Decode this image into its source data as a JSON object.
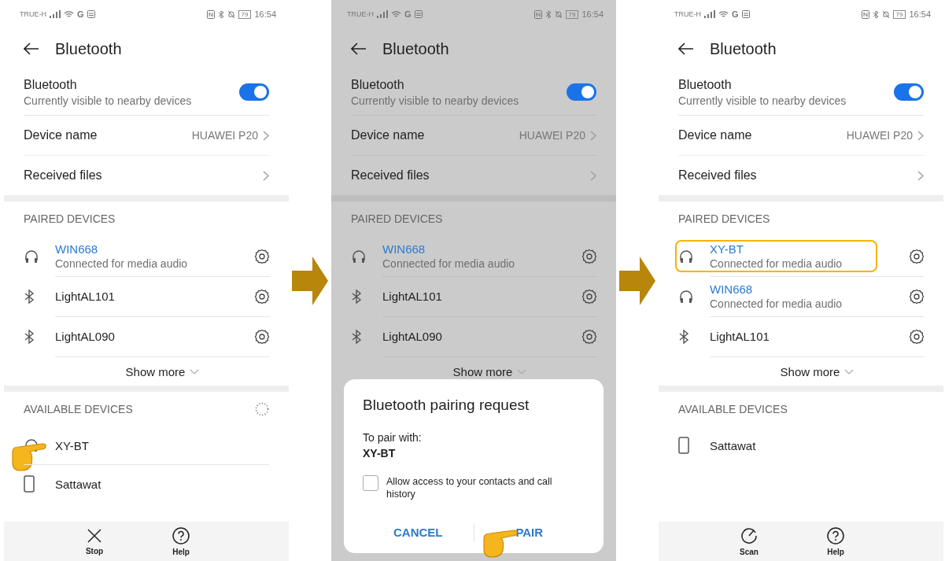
{
  "screens": [
    {
      "dimmed": false,
      "status_bar": {
        "carrier": "TRUE-H",
        "network": "G",
        "battery": "79",
        "time": "16:54"
      },
      "title": "Bluetooth",
      "bluetooth": {
        "label": "Bluetooth",
        "subtitle": "Currently visible to nearby devices",
        "on": true
      },
      "device_name": {
        "label": "Device name",
        "value": "HUAWEI P20"
      },
      "received_files": {
        "label": "Received files"
      },
      "paired": {
        "heading": "PAIRED DEVICES",
        "show_more": "Show more",
        "devices": [
          {
            "kind": "headphones",
            "name": "WIN668",
            "subtitle": "Connected for media audio",
            "connected": true,
            "highlighted": false
          },
          {
            "kind": "bluetooth",
            "name": "LightAL101",
            "connected": false,
            "highlighted": false
          },
          {
            "kind": "bluetooth",
            "name": "LightAL090",
            "connected": false,
            "highlighted": false
          }
        ]
      },
      "available": {
        "heading": "AVAILABLE DEVICES",
        "scanning": true,
        "devices": [
          {
            "kind": "headphones",
            "name": "XY-BT",
            "pointed": true
          },
          {
            "kind": "phone",
            "name": "Sattawat",
            "pointed": false
          }
        ]
      },
      "toolbar": [
        {
          "kind": "stop",
          "label": "Stop"
        },
        {
          "kind": "help",
          "label": "Help"
        }
      ]
    },
    {
      "dimmed": true,
      "status_bar": {
        "carrier": "TRUE-H",
        "network": "G",
        "battery": "79",
        "time": "16:54"
      },
      "title": "Bluetooth",
      "bluetooth": {
        "label": "Bluetooth",
        "subtitle": "Currently visible to nearby devices",
        "on": true
      },
      "device_name": {
        "label": "Device name",
        "value": "HUAWEI P20"
      },
      "received_files": {
        "label": "Received files"
      },
      "paired": {
        "heading": "PAIRED DEVICES",
        "show_more": "Show more",
        "devices": [
          {
            "kind": "headphones",
            "name": "WIN668",
            "subtitle": "Connected for media audio",
            "connected": true,
            "highlighted": false
          },
          {
            "kind": "bluetooth",
            "name": "LightAL101",
            "connected": false,
            "highlighted": false
          },
          {
            "kind": "bluetooth",
            "name": "LightAL090",
            "connected": false,
            "highlighted": false
          }
        ]
      },
      "dialog": {
        "title": "Bluetooth pairing request",
        "prompt": "To pair with:",
        "device": "XY-BT",
        "checkbox": {
          "label": "Allow access to your contacts and call history",
          "checked": false
        },
        "buttons": [
          {
            "label": "CANCEL",
            "pointed": false
          },
          {
            "label": "PAIR",
            "pointed": true
          }
        ]
      }
    },
    {
      "dimmed": false,
      "status_bar": {
        "carrier": "TRUE-H",
        "network": "G",
        "battery": "79",
        "time": "16:54"
      },
      "title": "Bluetooth",
      "bluetooth": {
        "label": "Bluetooth",
        "subtitle": "Currently visible to nearby devices",
        "on": true
      },
      "device_name": {
        "label": "Device name",
        "value": "HUAWEI P20"
      },
      "received_files": {
        "label": "Received files"
      },
      "paired": {
        "heading": "PAIRED DEVICES",
        "show_more": "Show more",
        "devices": [
          {
            "kind": "headphones",
            "name": "XY-BT",
            "subtitle": "Connected for media audio",
            "connected": true,
            "highlighted": true
          },
          {
            "kind": "headphones",
            "name": "WIN668",
            "subtitle": "Connected for media audio",
            "connected": true,
            "highlighted": false
          },
          {
            "kind": "bluetooth",
            "name": "LightAL101",
            "connected": false,
            "highlighted": false
          }
        ]
      },
      "available": {
        "heading": "AVAILABLE DEVICES",
        "scanning": false,
        "devices": [
          {
            "kind": "phone",
            "name": "Sattawat",
            "pointed": false
          }
        ]
      },
      "toolbar": [
        {
          "kind": "scan",
          "label": "Scan"
        },
        {
          "kind": "help",
          "label": "Help"
        }
      ]
    }
  ]
}
